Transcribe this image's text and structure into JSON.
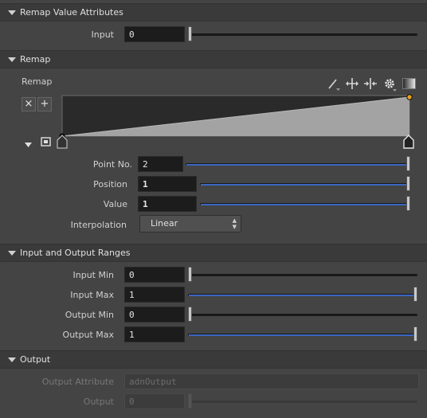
{
  "sections": {
    "remap_value_attributes": {
      "title": "Remap Value Attributes"
    },
    "remap": {
      "title": "Remap"
    },
    "ranges": {
      "title": "Input and Output Ranges"
    },
    "output": {
      "title": "Output"
    }
  },
  "remap_value_attributes": {
    "input": {
      "label": "Input",
      "value": "0",
      "fraction": 0.0
    }
  },
  "remap": {
    "ramp_label": "Remap",
    "delete_point_glyph": "×",
    "add_point_glyph": "+",
    "toolbar_icons": [
      "pencil-icon",
      "move-horizontal-icon",
      "split-icon",
      "gear-icon",
      "gradient-icon"
    ],
    "curve": {
      "start_value": 0,
      "end_value": 1,
      "selected_point": "end"
    },
    "point_no": {
      "label": "Point No.",
      "value": "2",
      "fraction": 1.0
    },
    "position": {
      "label": "Position",
      "value": "1",
      "fraction": 1.0
    },
    "value": {
      "label": "Value",
      "value": "1",
      "fraction": 1.0
    },
    "interpolation": {
      "label": "Interpolation",
      "value": "Linear"
    }
  },
  "ranges": {
    "input_min": {
      "label": "Input Min",
      "value": "0",
      "fraction": 0.0
    },
    "input_max": {
      "label": "Input Max",
      "value": "1",
      "fraction": 1.0
    },
    "output_min": {
      "label": "Output Min",
      "value": "0",
      "fraction": 0.0
    },
    "output_max": {
      "label": "Output Max",
      "value": "1",
      "fraction": 1.0
    }
  },
  "output": {
    "output_attribute": {
      "label": "Output Attribute",
      "value": "adnOutput"
    },
    "output_value": {
      "label": "Output",
      "value": "0",
      "fraction": 0.0
    }
  },
  "colors": {
    "slider_fill": "#3c67c2",
    "ramp_fill": "#a3a3a3",
    "ramp_background": "#2a2a2a",
    "selected_point": "#e6a11c"
  }
}
